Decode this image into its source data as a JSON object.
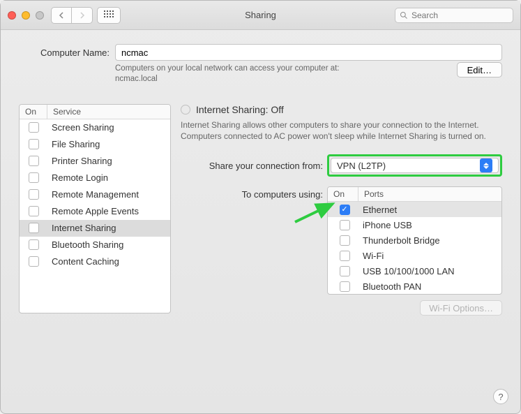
{
  "window": {
    "title": "Sharing"
  },
  "search": {
    "placeholder": "Search"
  },
  "computer": {
    "label": "Computer Name:",
    "value": "ncmac",
    "help_line1": "Computers on your local network can access your computer at:",
    "help_line2": "ncmac.local",
    "edit_label": "Edit…"
  },
  "services": {
    "col_on": "On",
    "col_service": "Service",
    "items": [
      {
        "label": "Screen Sharing",
        "on": false
      },
      {
        "label": "File Sharing",
        "on": false
      },
      {
        "label": "Printer Sharing",
        "on": false
      },
      {
        "label": "Remote Login",
        "on": false
      },
      {
        "label": "Remote Management",
        "on": false
      },
      {
        "label": "Remote Apple Events",
        "on": false
      },
      {
        "label": "Internet Sharing",
        "on": false,
        "selected": true
      },
      {
        "label": "Bluetooth Sharing",
        "on": false
      },
      {
        "label": "Content Caching",
        "on": false
      }
    ]
  },
  "detail": {
    "title": "Internet Sharing: Off",
    "description": "Internet Sharing allows other computers to share your connection to the Internet. Computers connected to AC power won't sleep while Internet Sharing is turned on.",
    "share_from_label": "Share your connection from:",
    "share_from_value": "VPN (L2TP)",
    "to_label": "To computers using:",
    "ports_col_on": "On",
    "ports_col_name": "Ports",
    "ports": [
      {
        "label": "Ethernet",
        "on": true,
        "selected": true
      },
      {
        "label": "iPhone USB",
        "on": false
      },
      {
        "label": "Thunderbolt Bridge",
        "on": false
      },
      {
        "label": "Wi-Fi",
        "on": false
      },
      {
        "label": "USB 10/100/1000 LAN",
        "on": false
      },
      {
        "label": "Bluetooth PAN",
        "on": false
      }
    ],
    "wifi_options_label": "Wi-Fi Options…"
  },
  "help_button": "?"
}
